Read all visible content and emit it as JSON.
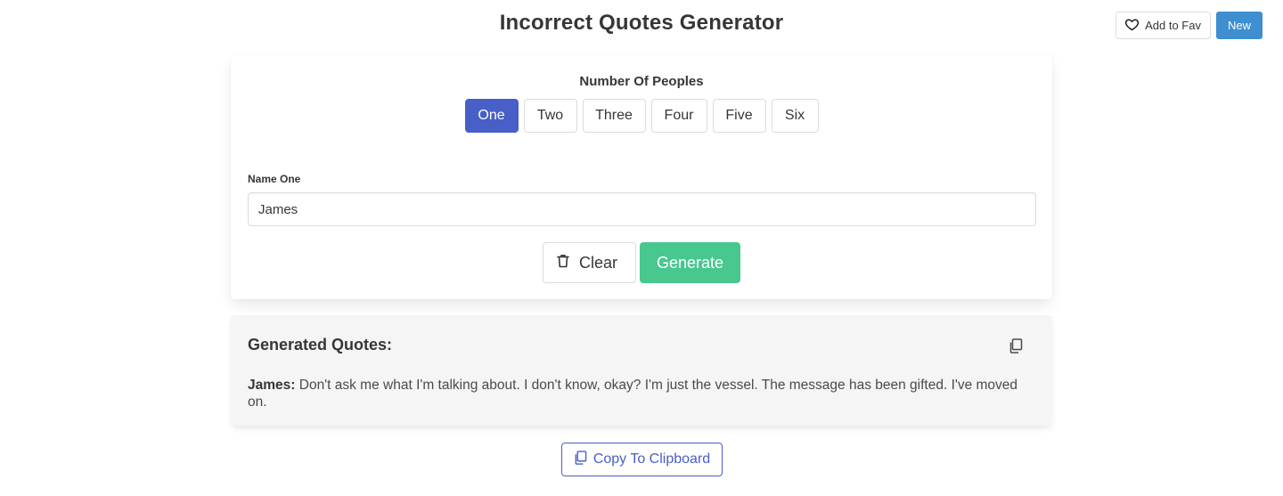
{
  "header": {
    "title": "Incorrect Quotes Generator",
    "fav_label": "Add to Fav",
    "fav_icon": "heart-icon",
    "new_label": "New"
  },
  "people": {
    "label": "Number Of Peoples",
    "options": [
      "One",
      "Two",
      "Three",
      "Four",
      "Five",
      "Six"
    ],
    "selected": "One"
  },
  "form": {
    "name_label": "Name One",
    "name_value": "James",
    "clear_label": "Clear",
    "clear_icon": "trash-icon",
    "generate_label": "Generate"
  },
  "result": {
    "title": "Generated Quotes:",
    "copy_icon": "copy-icon",
    "speaker": "James:",
    "quote": "Don't ask me what I'm talking about. I don't know, okay? I'm just the vessel. The message has been gifted. I've moved on."
  },
  "footer": {
    "copy_label": "Copy To Clipboard"
  },
  "colors": {
    "primary": "#485fc7",
    "success": "#48c78e",
    "info": "#3e8ed0"
  }
}
